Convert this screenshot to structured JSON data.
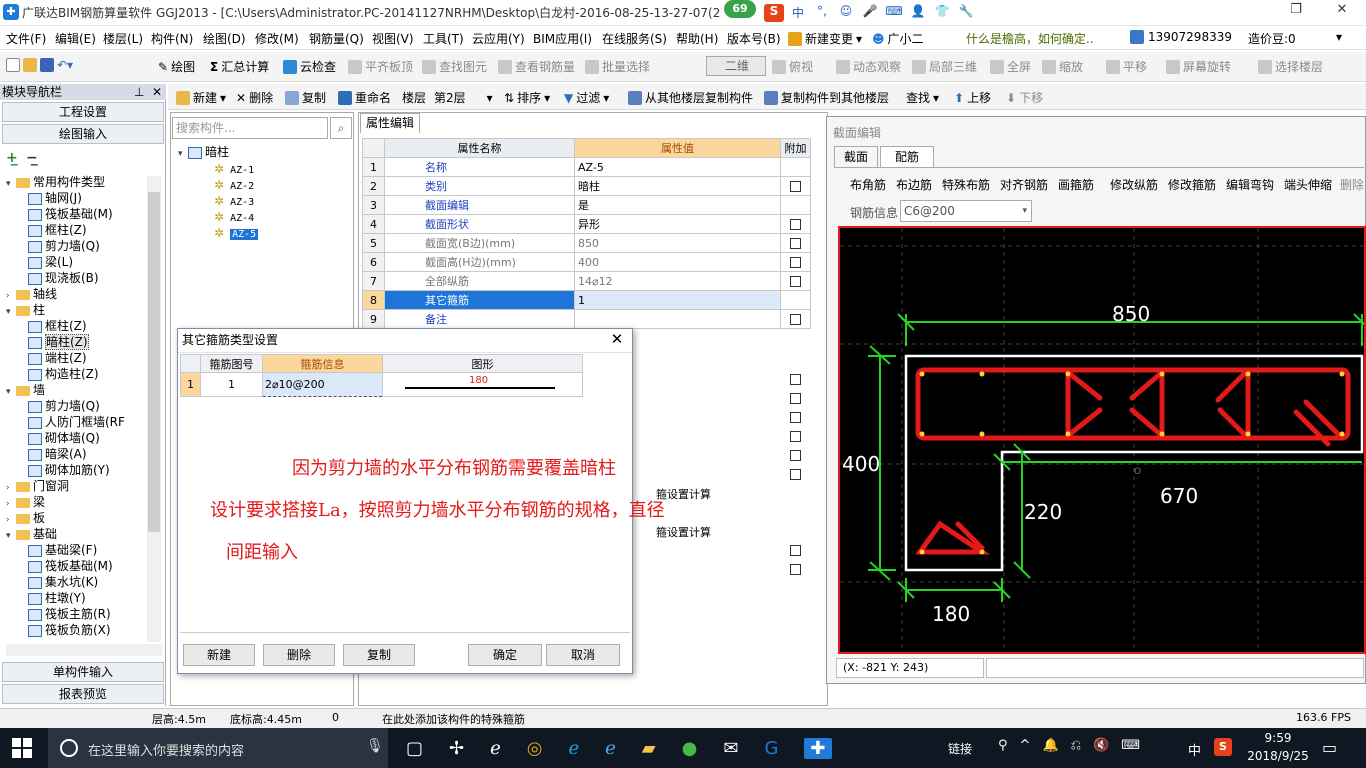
{
  "window": {
    "title": "广联达BIM钢筋算量软件 GGJ2013 - [C:\\Users\\Administrator.PC-20141127NRHM\\Desktop\\白龙村-2016-08-25-13-27-07(21",
    "badge": "69",
    "ime": [
      "中",
      "°,",
      "☺",
      "🎤",
      "⌨",
      "👤",
      "👕",
      "🔧"
    ]
  },
  "menu": [
    "文件(F)",
    "编辑(E)",
    "楼层(L)",
    "构件(N)",
    "绘图(D)",
    "修改(M)",
    "钢筋量(Q)",
    "视图(V)",
    "工具(T)",
    "云应用(Y)",
    "BIM应用(I)",
    "在线服务(S)",
    "帮助(H)",
    "版本号(B)",
    "新建变更",
    "广小二",
    "什么是檐高，如何确定..",
    "13907298339",
    "造价豆:0"
  ],
  "toolbar1": [
    "绘图",
    "汇总计算",
    "云检查",
    "平齐板顶",
    "查找图元",
    "查看钢筋量",
    "批量选择",
    "二维",
    "俯视",
    "动态观察",
    "局部三维",
    "全屏",
    "缩放",
    "平移",
    "屏幕旋转",
    "选择楼层"
  ],
  "toolbar2": [
    "新建",
    "删除",
    "复制",
    "重命名",
    "楼层",
    "第2层",
    "排序",
    "过滤",
    "从其他楼层复制构件",
    "复制构件到其他楼层",
    "查找",
    "上移",
    "下移"
  ],
  "nav": {
    "header": "模块导航栏",
    "top_buttons": [
      "工程设置",
      "绘图输入"
    ],
    "bottom_buttons": [
      "单构件输入",
      "报表预览"
    ],
    "tree": [
      {
        "label": "常用构件类型",
        "level": 0,
        "type": "folder",
        "expanded": true
      },
      {
        "label": "轴网(J)",
        "level": 1,
        "type": "leaf"
      },
      {
        "label": "筏板基础(M)",
        "level": 1,
        "type": "leaf"
      },
      {
        "label": "框柱(Z)",
        "level": 1,
        "type": "leaf"
      },
      {
        "label": "剪力墙(Q)",
        "level": 1,
        "type": "leaf"
      },
      {
        "label": "梁(L)",
        "level": 1,
        "type": "leaf"
      },
      {
        "label": "现浇板(B)",
        "level": 1,
        "type": "leaf"
      },
      {
        "label": "轴线",
        "level": 0,
        "type": "folder",
        "expanded": false
      },
      {
        "label": "柱",
        "level": 0,
        "type": "folder",
        "expanded": true
      },
      {
        "label": "框柱(Z)",
        "level": 1,
        "type": "leaf"
      },
      {
        "label": "暗柱(Z)",
        "level": 1,
        "type": "leaf",
        "selected": true
      },
      {
        "label": "端柱(Z)",
        "level": 1,
        "type": "leaf"
      },
      {
        "label": "构造柱(Z)",
        "level": 1,
        "type": "leaf"
      },
      {
        "label": "墙",
        "level": 0,
        "type": "folder",
        "expanded": true
      },
      {
        "label": "剪力墙(Q)",
        "level": 1,
        "type": "leaf"
      },
      {
        "label": "人防门框墙(RF",
        "level": 1,
        "type": "leaf"
      },
      {
        "label": "砌体墙(Q)",
        "level": 1,
        "type": "leaf"
      },
      {
        "label": "暗梁(A)",
        "level": 1,
        "type": "leaf"
      },
      {
        "label": "砌体加筋(Y)",
        "level": 1,
        "type": "leaf"
      },
      {
        "label": "门窗洞",
        "level": 0,
        "type": "folder",
        "expanded": false
      },
      {
        "label": "梁",
        "level": 0,
        "type": "folder",
        "expanded": false
      },
      {
        "label": "板",
        "level": 0,
        "type": "folder",
        "expanded": false
      },
      {
        "label": "基础",
        "level": 0,
        "type": "folder",
        "expanded": true
      },
      {
        "label": "基础梁(F)",
        "level": 1,
        "type": "leaf"
      },
      {
        "label": "筏板基础(M)",
        "level": 1,
        "type": "leaf"
      },
      {
        "label": "集水坑(K)",
        "level": 1,
        "type": "leaf"
      },
      {
        "label": "柱墩(Y)",
        "level": 1,
        "type": "leaf"
      },
      {
        "label": "筏板主筋(R)",
        "level": 1,
        "type": "leaf"
      },
      {
        "label": "筏板负筋(X)",
        "level": 1,
        "type": "leaf"
      }
    ]
  },
  "components": {
    "search_placeholder": "搜索构件...",
    "root": "暗柱",
    "items": [
      "AZ-1",
      "AZ-2",
      "AZ-3",
      "AZ-4",
      "AZ-5"
    ],
    "selected": "AZ-5"
  },
  "properties": {
    "tab": "属性编辑",
    "headers": [
      "属性名称",
      "属性值",
      "附加"
    ],
    "rows": [
      {
        "n": "1",
        "name": "名称",
        "value": "AZ-5",
        "extra": false,
        "grey": false
      },
      {
        "n": "2",
        "name": "类别",
        "value": "暗柱",
        "extra": true,
        "grey": false
      },
      {
        "n": "3",
        "name": "截面编辑",
        "value": "是",
        "extra": false,
        "grey": false
      },
      {
        "n": "4",
        "name": "截面形状",
        "value": "异形",
        "extra": true,
        "grey": false
      },
      {
        "n": "5",
        "name": "截面宽(B边)(mm)",
        "value": "850",
        "extra": true,
        "grey": true
      },
      {
        "n": "6",
        "name": "截面高(H边)(mm)",
        "value": "400",
        "extra": true,
        "grey": true
      },
      {
        "n": "7",
        "name": "全部纵筋",
        "value": "14⌀12",
        "extra": true,
        "grey": true
      },
      {
        "n": "8",
        "name": "其它箍筋",
        "value": "1",
        "extra": false,
        "grey": false,
        "selected": true
      },
      {
        "n": "9",
        "name": "备注",
        "value": "",
        "extra": true,
        "grey": false
      }
    ],
    "partial_1": "箍设置计算",
    "partial_2": "箍设置计算"
  },
  "section_editor": {
    "title": "截面编辑",
    "tabs": [
      "截面",
      "配筋"
    ],
    "active_tab": "配筋",
    "tools": [
      "布角筋",
      "布边筋",
      "特殊布筋",
      "对齐钢筋",
      "画箍筋",
      "修改纵筋",
      "修改箍筋",
      "编辑弯钩",
      "端头伸缩",
      "删除"
    ],
    "rebar_label": "钢筋信息",
    "rebar_value": "C6@200",
    "dims": {
      "top": "850",
      "left": "400",
      "mid_right": "670",
      "inner": "220",
      "bottom": "180"
    },
    "coords": "(X: -821 Y: 243)"
  },
  "dialog": {
    "title": "其它箍筋类型设置",
    "headers": [
      "箍筋图号",
      "箍筋信息",
      "图形"
    ],
    "row": {
      "n": "1",
      "code": "1",
      "info": "2⌀10@200",
      "shape_value": "180"
    },
    "buttons": [
      "新建",
      "删除",
      "复制",
      "确定",
      "取消"
    ],
    "annotation": [
      "因为剪力墙的水平分布钢筋需要覆盖暗柱",
      "设计要求搭接La，按照剪力墙水平分布钢筋的规格，直径",
      "间距输入"
    ]
  },
  "status": {
    "floor_height": "层高:4.5m",
    "base_height": "底标高:4.45m",
    "value": "0",
    "message": "在此处添加该构件的特殊箍筋",
    "fps": "163.6 FPS"
  },
  "taskbar": {
    "search_placeholder": "在这里输入你要搜索的内容",
    "link": "链接",
    "lang": "中",
    "time": "9:59",
    "date": "2018/9/25"
  },
  "colors": {
    "accent": "#1f7ad8",
    "highlight": "#fbd79d",
    "select": "#1e74d8",
    "rebar": "#e41919",
    "dim": "#27d227"
  }
}
